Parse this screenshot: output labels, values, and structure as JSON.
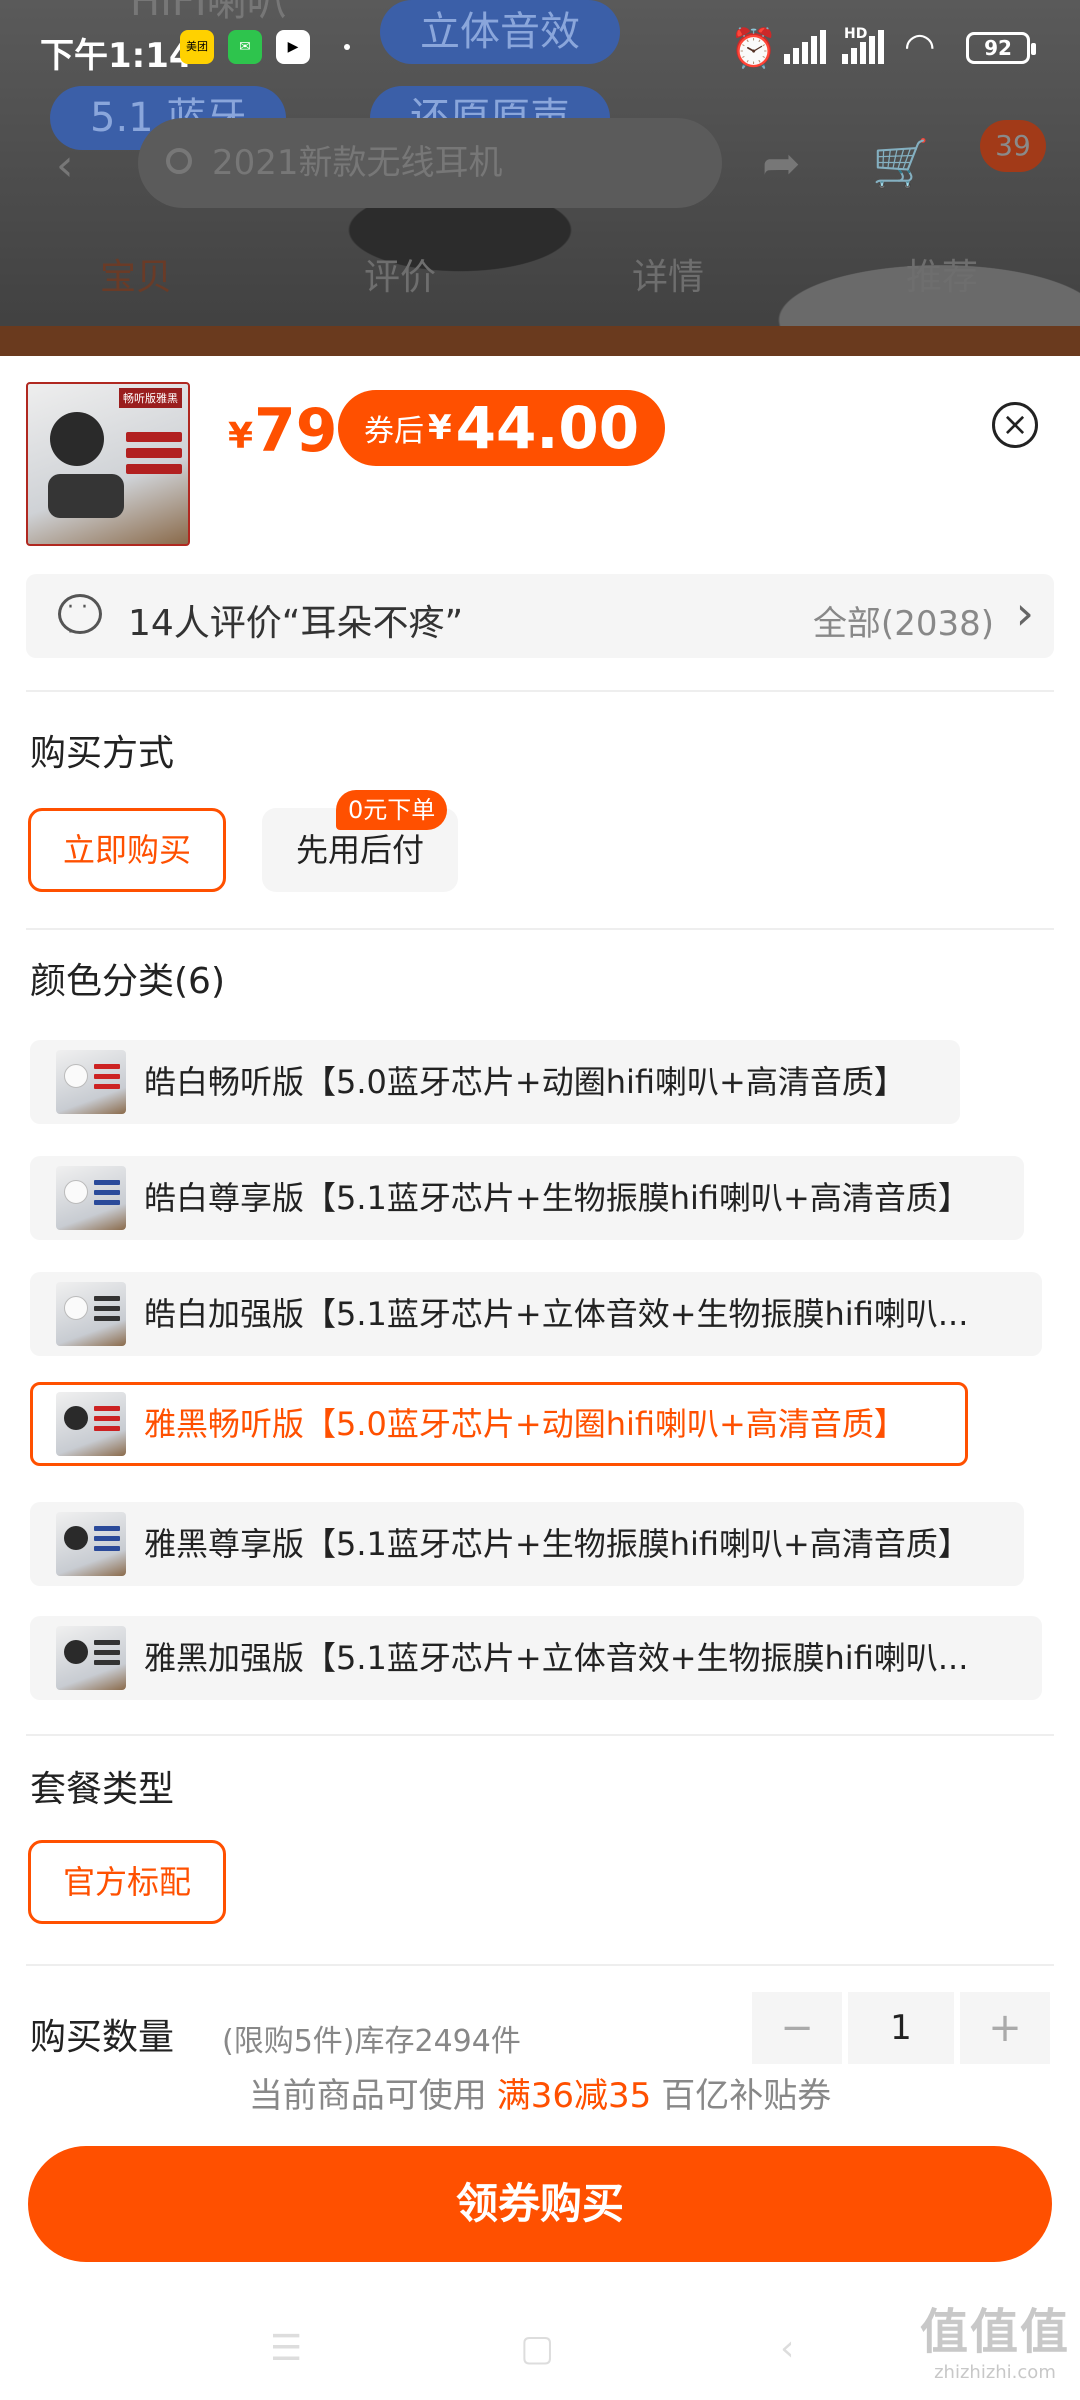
{
  "status_bar": {
    "time": "下午1:14",
    "apps": [
      "美团",
      "wechat",
      "video"
    ],
    "battery": "92",
    "hd": "HD",
    "wifi_label": "6"
  },
  "background_page": {
    "pills": [
      "HIFI喇叭",
      "立体音效",
      "5.1 蓝牙",
      "还原原声"
    ],
    "search_placeholder": "2021新款无线耳机",
    "cart_badge": "39",
    "tabs": [
      "宝贝",
      "评价",
      "详情",
      "推荐"
    ]
  },
  "product": {
    "price_yen": "¥",
    "price": "79",
    "coupon_label": "券后",
    "coupon_yen": "¥",
    "coupon_price": "44.00",
    "thumb_tag": "畅听版雅黑"
  },
  "review": {
    "text": "14人评价“耳朵不疼”",
    "all": "全部(2038)"
  },
  "purchase_method": {
    "title": "购买方式",
    "options": [
      "立即购买",
      "先用后付"
    ],
    "badge": "0元下单",
    "selected_index": 0
  },
  "color_category": {
    "title": "颜色分类(6)",
    "variants": [
      {
        "label": "皓白畅听版【5.0蓝牙芯片+动圈hifi喇叭+高清音质】",
        "tone": "white"
      },
      {
        "label": "皓白尊享版【5.1蓝牙芯片+生物振膜hifi喇叭+高清音质】",
        "tone": "white"
      },
      {
        "label": "皓白加强版【5.1蓝牙芯片+立体音效+生物振膜hifi喇叭...",
        "tone": "white"
      },
      {
        "label": "雅黑畅听版【5.0蓝牙芯片+动圈hifi喇叭+高清音质】",
        "tone": "black"
      },
      {
        "label": "雅黑尊享版【5.1蓝牙芯片+生物振膜hifi喇叭+高清音质】",
        "tone": "black"
      },
      {
        "label": "雅黑加强版【5.1蓝牙芯片+立体音效+生物振膜hifi喇叭...",
        "tone": "black"
      }
    ],
    "selected_index": 3
  },
  "package": {
    "title": "套餐类型",
    "options": [
      "官方标配"
    ],
    "selected_index": 0
  },
  "quantity": {
    "label": "购买数量",
    "limit": "(限购5件)库存2494件",
    "value": "1",
    "minus": "−",
    "plus": "+"
  },
  "subsidy": {
    "prefix": "当前商品可使用",
    "highlight": "满36减35",
    "suffix": "百亿补贴券"
  },
  "buy_button": "领券购买",
  "watermark": {
    "logo": "值值值",
    "url": "zhizhizhi.com"
  },
  "colors": {
    "accent": "#ff5000",
    "option_bg": "#f5f5f5",
    "text_gray": "#888888"
  },
  "icons": [
    "back-arrow-icon",
    "search-icon",
    "share-icon",
    "cart-icon",
    "close-icon",
    "comment-icon",
    "chevron-right-icon",
    "menu-icon",
    "home-icon",
    "back-icon"
  ]
}
